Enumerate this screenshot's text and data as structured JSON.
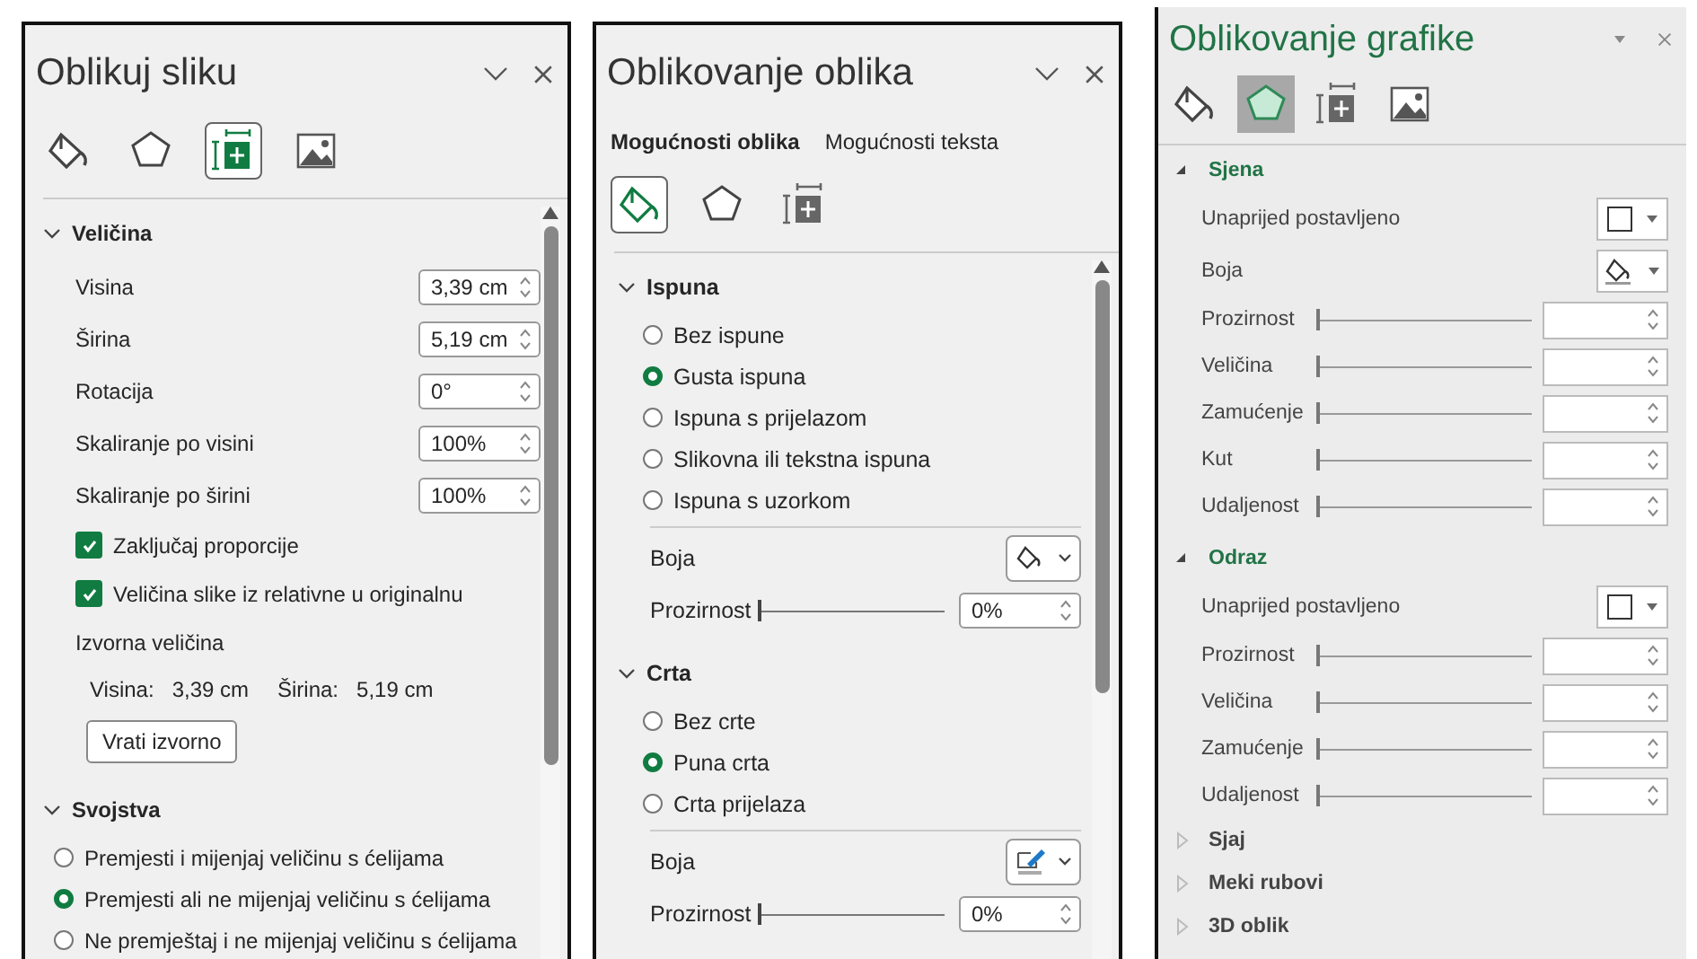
{
  "panels": [
    {
      "kind": "modern",
      "title": "Oblikuj sliku",
      "tabs": [
        {
          "selected": false
        },
        {
          "selected": false
        },
        {
          "selected": true
        },
        {
          "selected": false
        }
      ],
      "sections": [
        {
          "title": "Veličina",
          "expanded": true,
          "rows": [
            {
              "kind": "spin",
              "label": "Visina",
              "value": "3,39 cm"
            },
            {
              "kind": "spin",
              "label": "Širina",
              "value": "5,19 cm"
            },
            {
              "kind": "spin",
              "label": "Rotacija",
              "value": "0°"
            },
            {
              "kind": "spin",
              "label": "Skaliranje po visini",
              "value": "100%"
            },
            {
              "kind": "spin",
              "label": "Skaliranje po širini",
              "value": "100%"
            },
            {
              "kind": "checkbox",
              "label": "Zaključaj proporcije",
              "checked": true
            },
            {
              "kind": "checkbox",
              "label": "Veličina slike iz relativne u originalnu",
              "checked": true
            },
            {
              "kind": "note",
              "label": "Izvorna veličina"
            },
            {
              "kind": "dims",
              "items": [
                "Visina:",
                "3,39 cm",
                "Širina:",
                "5,19 cm"
              ]
            },
            {
              "kind": "button",
              "label": "Vrati izvorno"
            }
          ]
        },
        {
          "title": "Svojstva",
          "expanded": true,
          "rows": [
            {
              "kind": "radio",
              "label": "Premjesti i mijenjaj veličinu s ćelijama",
              "selected": false
            },
            {
              "kind": "radio",
              "label": "Premjesti ali ne mijenjaj veličinu s ćelijama",
              "selected": true
            },
            {
              "kind": "radio",
              "label": "Ne premještaj i ne mijenjaj veličinu s ćelijama",
              "selected": false
            }
          ]
        }
      ]
    },
    {
      "kind": "modern",
      "title": "Oblikovanje oblika",
      "option_tabs": [
        {
          "label": "Mogućnosti oblika",
          "selected": true
        },
        {
          "label": "Mogućnosti teksta",
          "selected": false
        }
      ],
      "tabs": [
        {
          "selected": true
        },
        {
          "selected": false
        },
        {
          "selected": false
        }
      ],
      "sections": [
        {
          "title": "Ispuna",
          "expanded": true,
          "rows": [
            {
              "kind": "radio",
              "label": "Bez ispune",
              "selected": false
            },
            {
              "kind": "radio",
              "label": "Gusta ispuna",
              "selected": true
            },
            {
              "kind": "radio",
              "label": "Ispuna s prijelazom",
              "selected": false
            },
            {
              "kind": "radio",
              "label": "Slikovna ili tekstna ispuna",
              "selected": false
            },
            {
              "kind": "radio",
              "label": "Ispuna s uzorkom",
              "selected": false
            },
            {
              "kind": "divider"
            },
            {
              "kind": "fillcolor",
              "label": "Boja"
            },
            {
              "kind": "slider",
              "label": "Prozirnost",
              "level": 0,
              "value": "0%"
            }
          ]
        },
        {
          "title": "Crta",
          "expanded": true,
          "rows": [
            {
              "kind": "radio",
              "label": "Bez crte",
              "selected": false
            },
            {
              "kind": "radio",
              "label": "Puna crta",
              "selected": true
            },
            {
              "kind": "radio",
              "label": "Crta prijelaza",
              "selected": false
            },
            {
              "kind": "divider"
            },
            {
              "kind": "linecolor",
              "label": "Boja"
            },
            {
              "kind": "slider",
              "label": "Prozirnost",
              "level": 0,
              "value": "0%"
            }
          ]
        }
      ]
    },
    {
      "kind": "classic",
      "title": "Oblikovanje grafike",
      "tabs": [
        {
          "selected": false
        },
        {
          "selected": true
        },
        {
          "selected": false
        },
        {
          "selected": false
        }
      ],
      "sections": [
        {
          "title": "Sjena",
          "expanded": true,
          "rows": [
            {
              "kind": "preset",
              "label": "Unaprijed postavljeno"
            },
            {
              "kind": "fillcolor",
              "label": "Boja"
            },
            {
              "kind": "slider",
              "label": "Prozirnost",
              "level": 0
            },
            {
              "kind": "slider",
              "label": "Veličina",
              "level": 0
            },
            {
              "kind": "slider",
              "label": "Zamućenje",
              "level": 0
            },
            {
              "kind": "slider",
              "label": "Kut",
              "level": 0
            },
            {
              "kind": "slider",
              "label": "Udaljenost",
              "level": 0
            }
          ]
        },
        {
          "title": "Odraz",
          "expanded": true,
          "rows": [
            {
              "kind": "preset",
              "label": "Unaprijed postavljeno"
            },
            {
              "kind": "slider",
              "label": "Prozirnost",
              "level": 0
            },
            {
              "kind": "slider",
              "label": "Veličina",
              "level": 0
            },
            {
              "kind": "slider",
              "label": "Zamućenje",
              "level": 0
            },
            {
              "kind": "slider",
              "label": "Udaljenost",
              "level": 0
            }
          ]
        },
        {
          "title": "Sjaj",
          "expanded": false
        },
        {
          "title": "Meki rubovi",
          "expanded": false
        },
        {
          "title": "3D oblik",
          "expanded": false
        }
      ]
    }
  ]
}
